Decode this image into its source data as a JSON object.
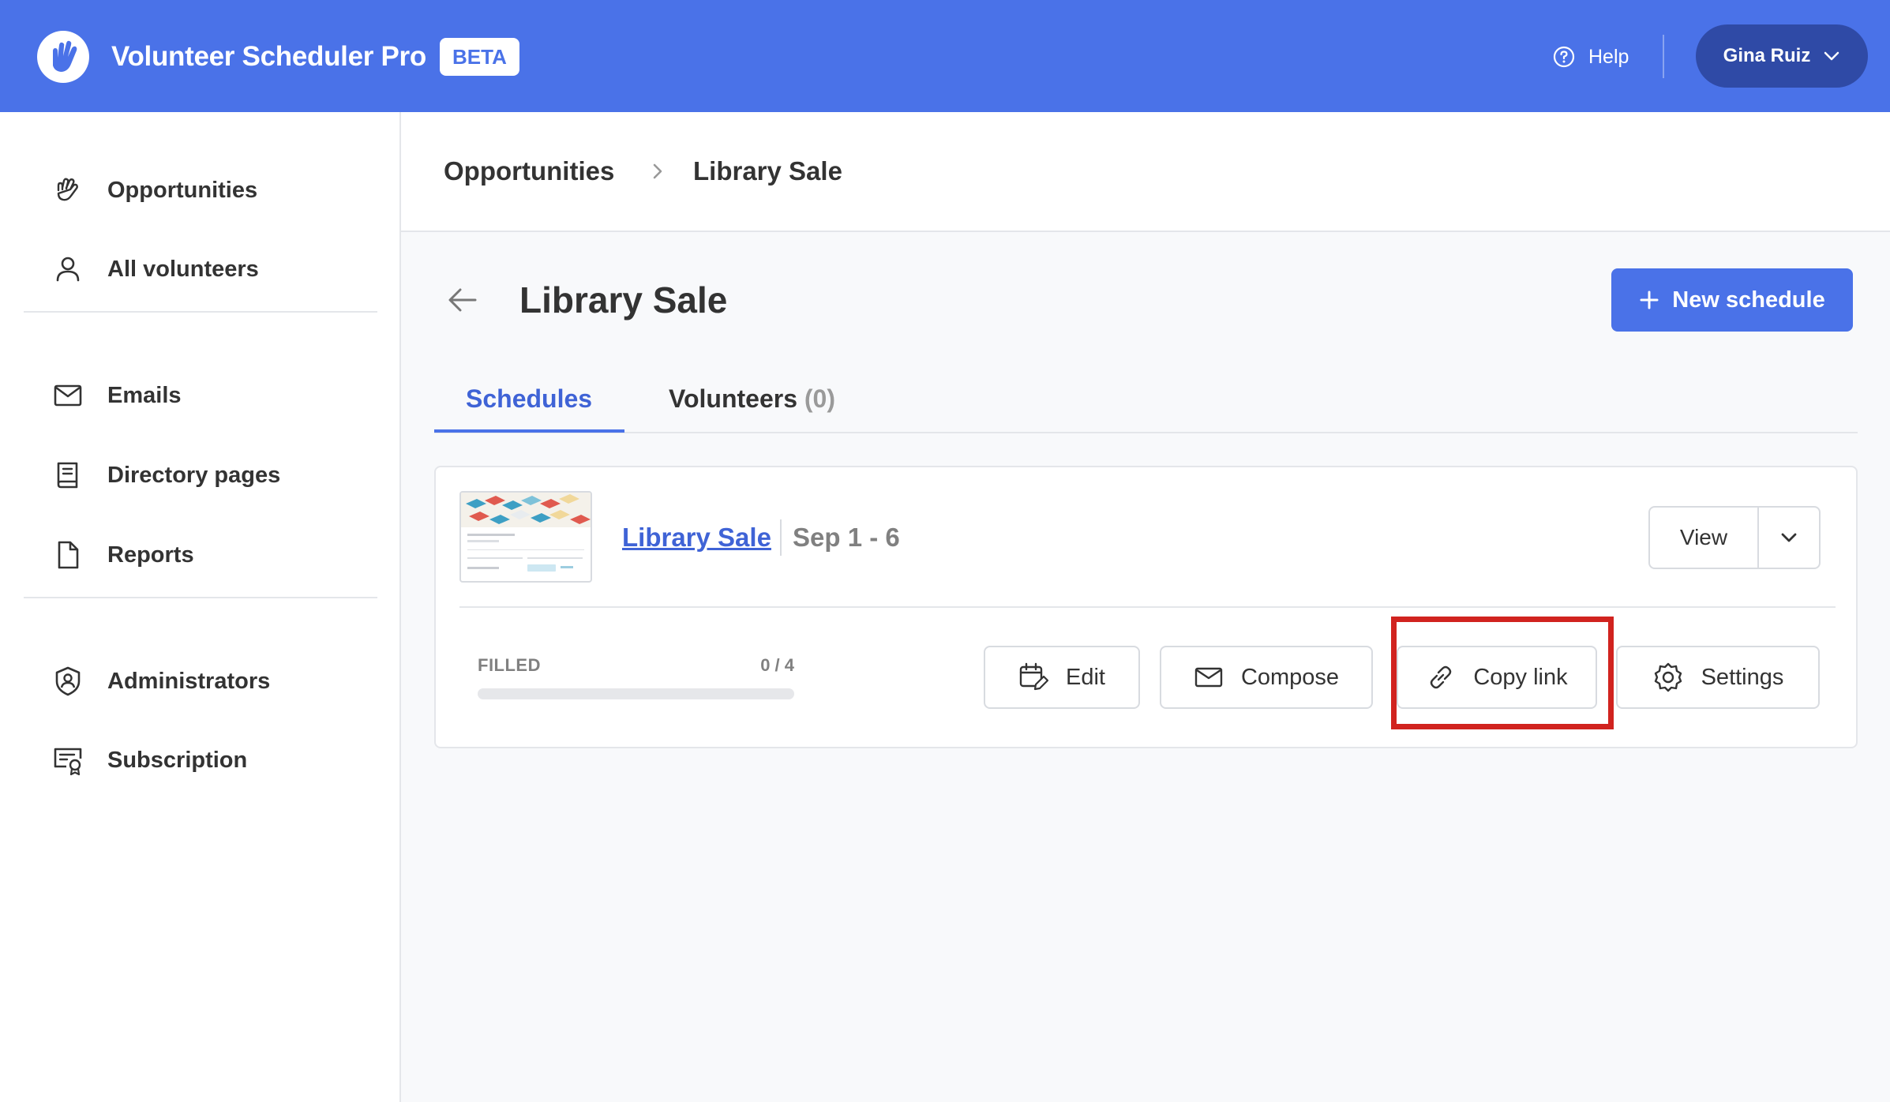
{
  "header": {
    "app_title": "Volunteer Scheduler Pro",
    "badge": "BETA",
    "help_label": "Help",
    "user_name": "Gina Ruiz"
  },
  "sidebar": {
    "items": [
      {
        "label": "Opportunities",
        "icon": "hand-icon"
      },
      {
        "label": "All volunteers",
        "icon": "user-icon"
      },
      {
        "label": "Emails",
        "icon": "envelope-icon"
      },
      {
        "label": "Directory pages",
        "icon": "book-icon"
      },
      {
        "label": "Reports",
        "icon": "document-icon"
      },
      {
        "label": "Administrators",
        "icon": "shield-user-icon"
      },
      {
        "label": "Subscription",
        "icon": "certificate-icon"
      }
    ]
  },
  "breadcrumb": {
    "parent": "Opportunities",
    "current": "Library Sale"
  },
  "page": {
    "title": "Library Sale",
    "new_schedule_label": "New schedule"
  },
  "tabs": [
    {
      "label": "Schedules",
      "active": true
    },
    {
      "label": "Volunteers",
      "count": "(0)",
      "active": false
    }
  ],
  "schedule_card": {
    "name": "Library Sale",
    "dates": "Sep 1 - 6",
    "view_label": "View",
    "filled_label": "FILLED",
    "filled_count": "0 / 4",
    "filled_fraction": 0,
    "actions": {
      "edit": "Edit",
      "compose": "Compose",
      "copy_link": "Copy link",
      "settings": "Settings"
    }
  },
  "colors": {
    "brand": "#4a72e8",
    "user_pill": "#2f4aa6",
    "highlight": "#d1231f"
  }
}
